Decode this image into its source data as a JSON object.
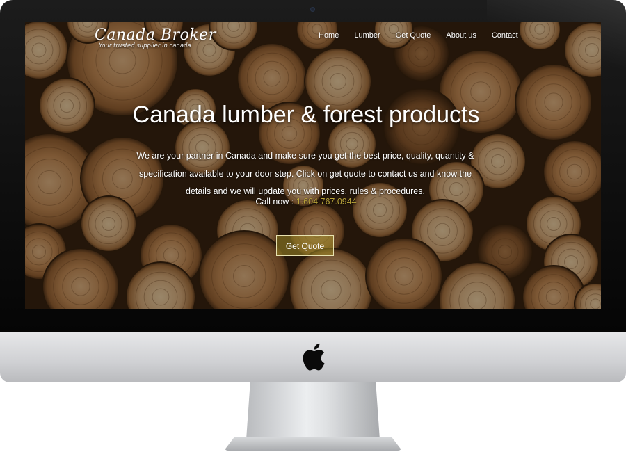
{
  "site": {
    "brand_name": "Canada Broker",
    "brand_tagline": "Your trusted supplier in canada"
  },
  "nav": {
    "items": [
      {
        "label": "Home"
      },
      {
        "label": "Lumber"
      },
      {
        "label": "Get Quote"
      },
      {
        "label": "About us"
      },
      {
        "label": "Contact"
      }
    ]
  },
  "hero": {
    "title": "Canada lumber & forest products",
    "body": "We are your partner in Canada and make sure you get the best price, quality, quantity & specification available to your door step. Click on get quote to contact us and know the details and we will update you with prices, rules & procedures.",
    "call_label": "Call now : ",
    "phone": "1.604.767.0944",
    "button_label": "Get Quote"
  },
  "colors": {
    "phone_accent": "#b9a43a",
    "button_fill": "#a08c28",
    "background_wood": "#8a5a30"
  },
  "icons": {
    "device_logo": "apple-logo-icon",
    "camera": "webcam-icon"
  }
}
